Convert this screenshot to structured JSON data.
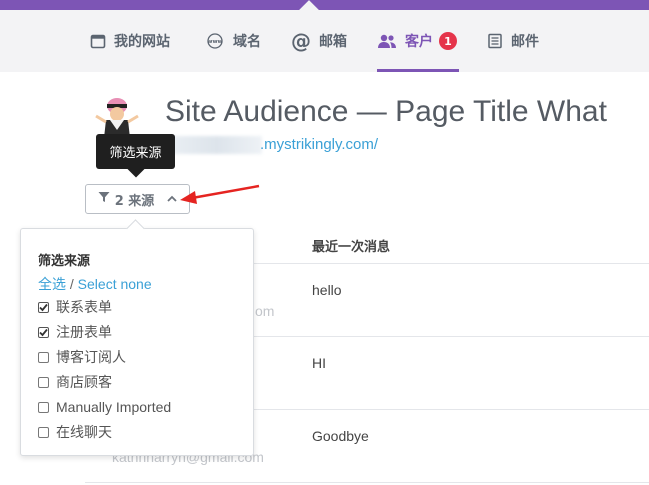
{
  "nav": {
    "items": [
      {
        "label": "我的网站",
        "icon": "calendar-icon"
      },
      {
        "label": "域名",
        "icon": "www-icon"
      },
      {
        "label": "邮箱",
        "icon": "at-icon"
      },
      {
        "label": "客户",
        "icon": "users-icon",
        "badge": "1",
        "active": true
      },
      {
        "label": "邮件",
        "icon": "newsletter-icon"
      }
    ]
  },
  "site": {
    "title": "Site Audience — Page Title What",
    "url": ".mystrikingly.com/"
  },
  "tooltip": {
    "text": "筛选来源"
  },
  "filter_button": {
    "label": "2 来源"
  },
  "table": {
    "header_last_message": "最近一次消息",
    "rows": [
      {
        "message": "hello",
        "email_fragment": "om"
      },
      {
        "message": "HI"
      },
      {
        "message": "Goodbye",
        "email_fragment": "kathrinarryn@gmail.com"
      }
    ]
  },
  "dropdown": {
    "title": "筛选来源",
    "select_all": "全选",
    "separator": "/",
    "select_none": "Select none",
    "options": [
      {
        "label": "联系表单",
        "checked": true
      },
      {
        "label": "注册表单",
        "checked": true
      },
      {
        "label": "博客订阅人",
        "checked": false
      },
      {
        "label": "商店顾客",
        "checked": false
      },
      {
        "label": "Manually Imported",
        "checked": false
      },
      {
        "label": "在线聊天",
        "checked": false
      }
    ]
  },
  "colors": {
    "accent": "#7d55b5",
    "link": "#3aa0d6",
    "badge": "#e5344b",
    "arrow": "#e52421"
  }
}
